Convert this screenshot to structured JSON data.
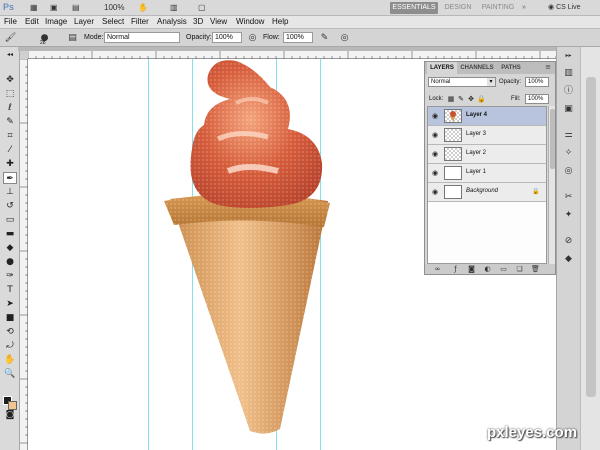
{
  "app": {
    "logo": "Ps",
    "zoom": "100%",
    "workspaces": [
      "ESSENTIALS",
      "DESIGN",
      "PAINTING"
    ],
    "more_glyph": "»",
    "cs_live": "CS Live"
  },
  "menu": [
    "File",
    "Edit",
    "Image",
    "Layer",
    "Select",
    "Filter",
    "Analysis",
    "3D",
    "View",
    "Window",
    "Help"
  ],
  "options": {
    "brush_size": "28",
    "mode_label": "Mode:",
    "mode_value": "Normal",
    "opacity_label": "Opacity:",
    "opacity_value": "100%",
    "flow_label": "Flow:",
    "flow_value": "100%"
  },
  "layers_panel": {
    "tabs": [
      "LAYERS",
      "CHANNELS",
      "PATHS"
    ],
    "blend_mode": "Normal",
    "opacity_label": "Opacity:",
    "opacity_value": "100%",
    "lock_label": "Lock:",
    "fill_label": "Fill:",
    "fill_value": "100%",
    "layers": [
      {
        "name": "Layer 4",
        "active": true
      },
      {
        "name": "Layer 3",
        "active": false
      },
      {
        "name": "Layer 2",
        "active": false
      },
      {
        "name": "Layer 1",
        "active": false
      },
      {
        "name": "Background",
        "active": false
      }
    ]
  },
  "colors": {
    "foreground": "#1e1e1e",
    "background": "#f2c48f",
    "guides": "#5ad7e6",
    "active_layer": "#b8c4dd"
  },
  "watermark": "pxleyes.com"
}
